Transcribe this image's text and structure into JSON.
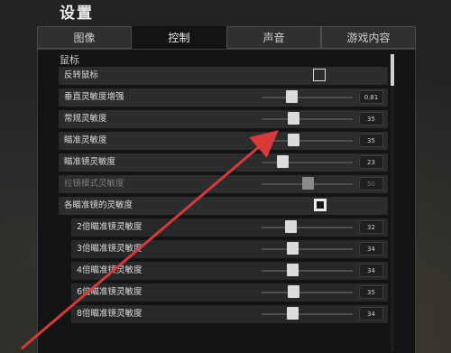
{
  "title": "设置",
  "tabs": [
    {
      "label": "图像",
      "active": false
    },
    {
      "label": "控制",
      "active": true
    },
    {
      "label": "声音",
      "active": false
    },
    {
      "label": "游戏内容",
      "active": false
    }
  ],
  "section": "鼠标",
  "rows": [
    {
      "label": "反转鼠标",
      "type": "checkbox",
      "checked": false
    },
    {
      "label": "垂直灵敏度增强",
      "type": "slider",
      "value": "0.81",
      "level": 0.33
    },
    {
      "label": "常规灵敏度",
      "type": "slider",
      "value": "35",
      "level": 0.35
    },
    {
      "label": "瞄准灵敏度",
      "type": "slider",
      "value": "35",
      "level": 0.35
    },
    {
      "label": "瞄准镜灵敏度",
      "type": "slider",
      "value": "23",
      "level": 0.23
    },
    {
      "label": "拉镜模式灵敏度",
      "type": "slider",
      "value": "50",
      "level": 0.5,
      "disabled": true
    },
    {
      "label": "各瞄准镜的灵敏度",
      "type": "checkbox",
      "checked": true
    },
    {
      "label": "2倍瞄准镜灵敏度",
      "type": "slider",
      "value": "32",
      "level": 0.32,
      "sub": true
    },
    {
      "label": "3倍瞄准镜灵敏度",
      "type": "slider",
      "value": "34",
      "level": 0.34,
      "sub": true
    },
    {
      "label": "4倍瞄准镜灵敏度",
      "type": "slider",
      "value": "34",
      "level": 0.34,
      "sub": true
    },
    {
      "label": "6倍瞄准镜灵敏度",
      "type": "slider",
      "value": "35",
      "level": 0.35,
      "sub": true
    },
    {
      "label": "8倍瞄准镜灵敏度",
      "type": "slider",
      "value": "34",
      "level": 0.34,
      "sub": true
    }
  ],
  "colors": {
    "accent": "#ededed",
    "annotation": "#d83a3a"
  }
}
